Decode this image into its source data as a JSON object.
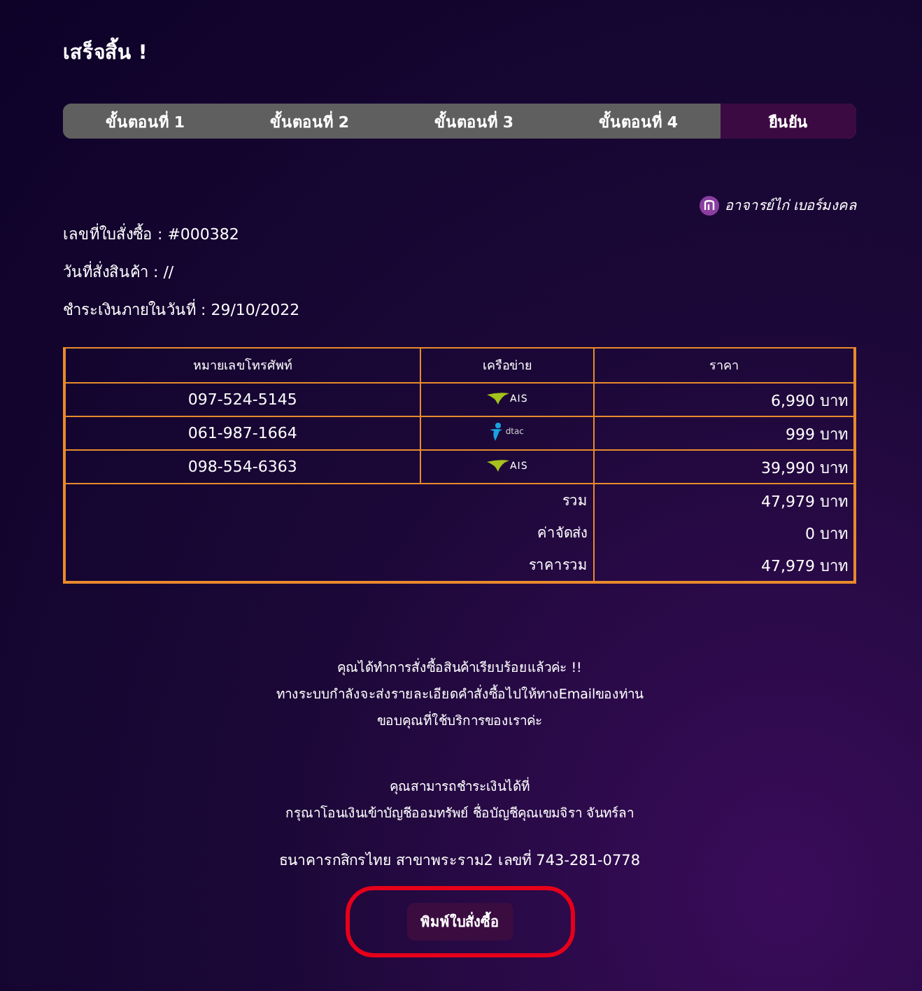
{
  "title": "เสร็จสิ้น !",
  "steps": [
    {
      "label": "ขั้นตอนที่ 1",
      "selected": false
    },
    {
      "label": "ขั้นตอนที่ 2",
      "selected": false
    },
    {
      "label": "ขั้นตอนที่ 3",
      "selected": false
    },
    {
      "label": "ขั้นตอนที่ 4",
      "selected": false
    },
    {
      "label": "ยืนยัน",
      "selected": true
    }
  ],
  "brand": {
    "name": "อาจารย์ไก่ เบอร์มงคล"
  },
  "order_info": [
    "เลขที่ใบสั่งซื้อ : #000382",
    "วันที่สั่งสินค้า : //",
    "ชำระเงินภายในวันที่ : 29/10/2022"
  ],
  "table": {
    "columns": [
      "หมายเลขโทรศัพท์",
      "เครือข่าย",
      "ราคา"
    ],
    "rows": [
      {
        "phone": "097-524-5145",
        "network": {
          "kind": "ais",
          "text": "AIS"
        },
        "price": "6,990 บาท"
      },
      {
        "phone": "061-987-1664",
        "network": {
          "kind": "dtac",
          "text": "dtac"
        },
        "price": "999 บาท"
      },
      {
        "phone": "098-554-6363",
        "network": {
          "kind": "ais",
          "text": "AIS"
        },
        "price": "39,990 บาท"
      }
    ],
    "totals": [
      {
        "label": "รวม",
        "value": "47,979 บาท"
      },
      {
        "label": "ค่าจัดส่ง",
        "value": "0 บาท"
      },
      {
        "label": "ราคารวม",
        "value": "47,979 บาท"
      }
    ]
  },
  "thanks": [
    "คุณได้ทำการสั่งซื้อสินค้าเรียบร้อยแล้วค่ะ !!",
    "ทางระบบกำลังจะส่งรายละเอียดคำสั่งซื้อไปให้ทางEmailของท่าน",
    "ขอบคุณที่ใช้บริการของเราค่ะ"
  ],
  "payment": [
    "คุณสามารถชำระเงินได้ที่",
    "กรุณาโอนเงินเข้าบัญชีออมทรัพย์ ชื่อบัญชีคุณเขมจิรา จันทร์ลา",
    "ธนาคารกสิกรไทย สาขาพระราม2 เลขที่ 743-281-0778"
  ],
  "print_button": {
    "label": "พิมพ์ใบสั่งซื้อ",
    "highlighted": true
  }
}
